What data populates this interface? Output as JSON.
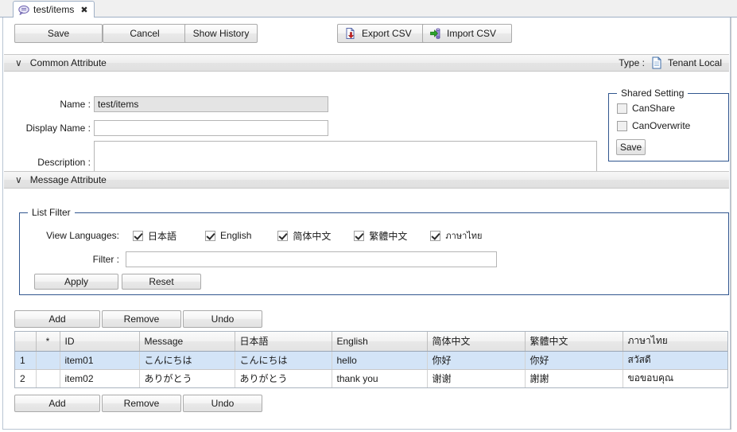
{
  "tab": {
    "label": "test/items",
    "icon": "message-bubble-icon",
    "close": "✖"
  },
  "toolbar": {
    "save": "Save",
    "cancel": "Cancel",
    "show_history": "Show History",
    "export_csv": "Export CSV",
    "import_csv": "Import CSV"
  },
  "common_attribute": {
    "title": "Common Attribute",
    "chevron": "∨",
    "type_label": "Type :",
    "type_value": "Tenant Local",
    "fields": {
      "name_label": "Name :",
      "name_value": "test/items",
      "display_name_label": "Display Name :",
      "display_name_value": "",
      "display_name_placeholder": "",
      "description_label": "Description :",
      "description_value": "",
      "description_placeholder": ""
    },
    "shared_setting": {
      "legend": "Shared Setting",
      "can_share_label": "CanShare",
      "can_share_checked": false,
      "can_overwrite_label": "CanOverwrite",
      "can_overwrite_checked": false,
      "save_label": "Save"
    }
  },
  "message_attribute": {
    "title": "Message Attribute",
    "chevron": "∨",
    "list_filter": {
      "legend": "List Filter",
      "view_languages_label": "View Languages:",
      "languages": [
        {
          "label": "日本語",
          "checked": true
        },
        {
          "label": "English",
          "checked": true
        },
        {
          "label": "简体中文",
          "checked": true
        },
        {
          "label": "繁體中文",
          "checked": true
        },
        {
          "label": "ภาษาไทย",
          "checked": true
        }
      ],
      "filter_label": "Filter :",
      "filter_value": "",
      "filter_placeholder": "",
      "apply_label": "Apply",
      "reset_label": "Reset"
    },
    "grid_buttons_top": {
      "add": "Add",
      "remove": "Remove",
      "undo": "Undo"
    },
    "grid_buttons_bottom": {
      "add": "Add",
      "remove": "Remove",
      "undo": "Undo"
    },
    "grid": {
      "columns": [
        "",
        "*",
        "ID",
        "Message",
        "日本語",
        "English",
        "简体中文",
        "繁體中文",
        "ภาษาไทย"
      ],
      "rows": [
        {
          "num": "1",
          "star": "",
          "id": "item01",
          "message": "こんにちは",
          "ja": "こんにちは",
          "en": "hello",
          "zh_cn": "你好",
          "zh_tw": "你好",
          "th": "สวัสดี",
          "selected": true
        },
        {
          "num": "2",
          "star": "",
          "id": "item02",
          "message": "ありがとう",
          "ja": "ありがとう",
          "en": "thank you",
          "zh_cn": "谢谢",
          "zh_tw": "謝謝",
          "th": "ขอขอบคุณ",
          "selected": false
        }
      ]
    }
  },
  "colors": {
    "tab_border": "#9fb0c6",
    "panel_border": "#b9c5d3",
    "fieldset_border": "#31568f",
    "row_selected": "#d3e4f7",
    "export_arrow": "#cc2222",
    "import_arrow": "#2ea32e"
  }
}
